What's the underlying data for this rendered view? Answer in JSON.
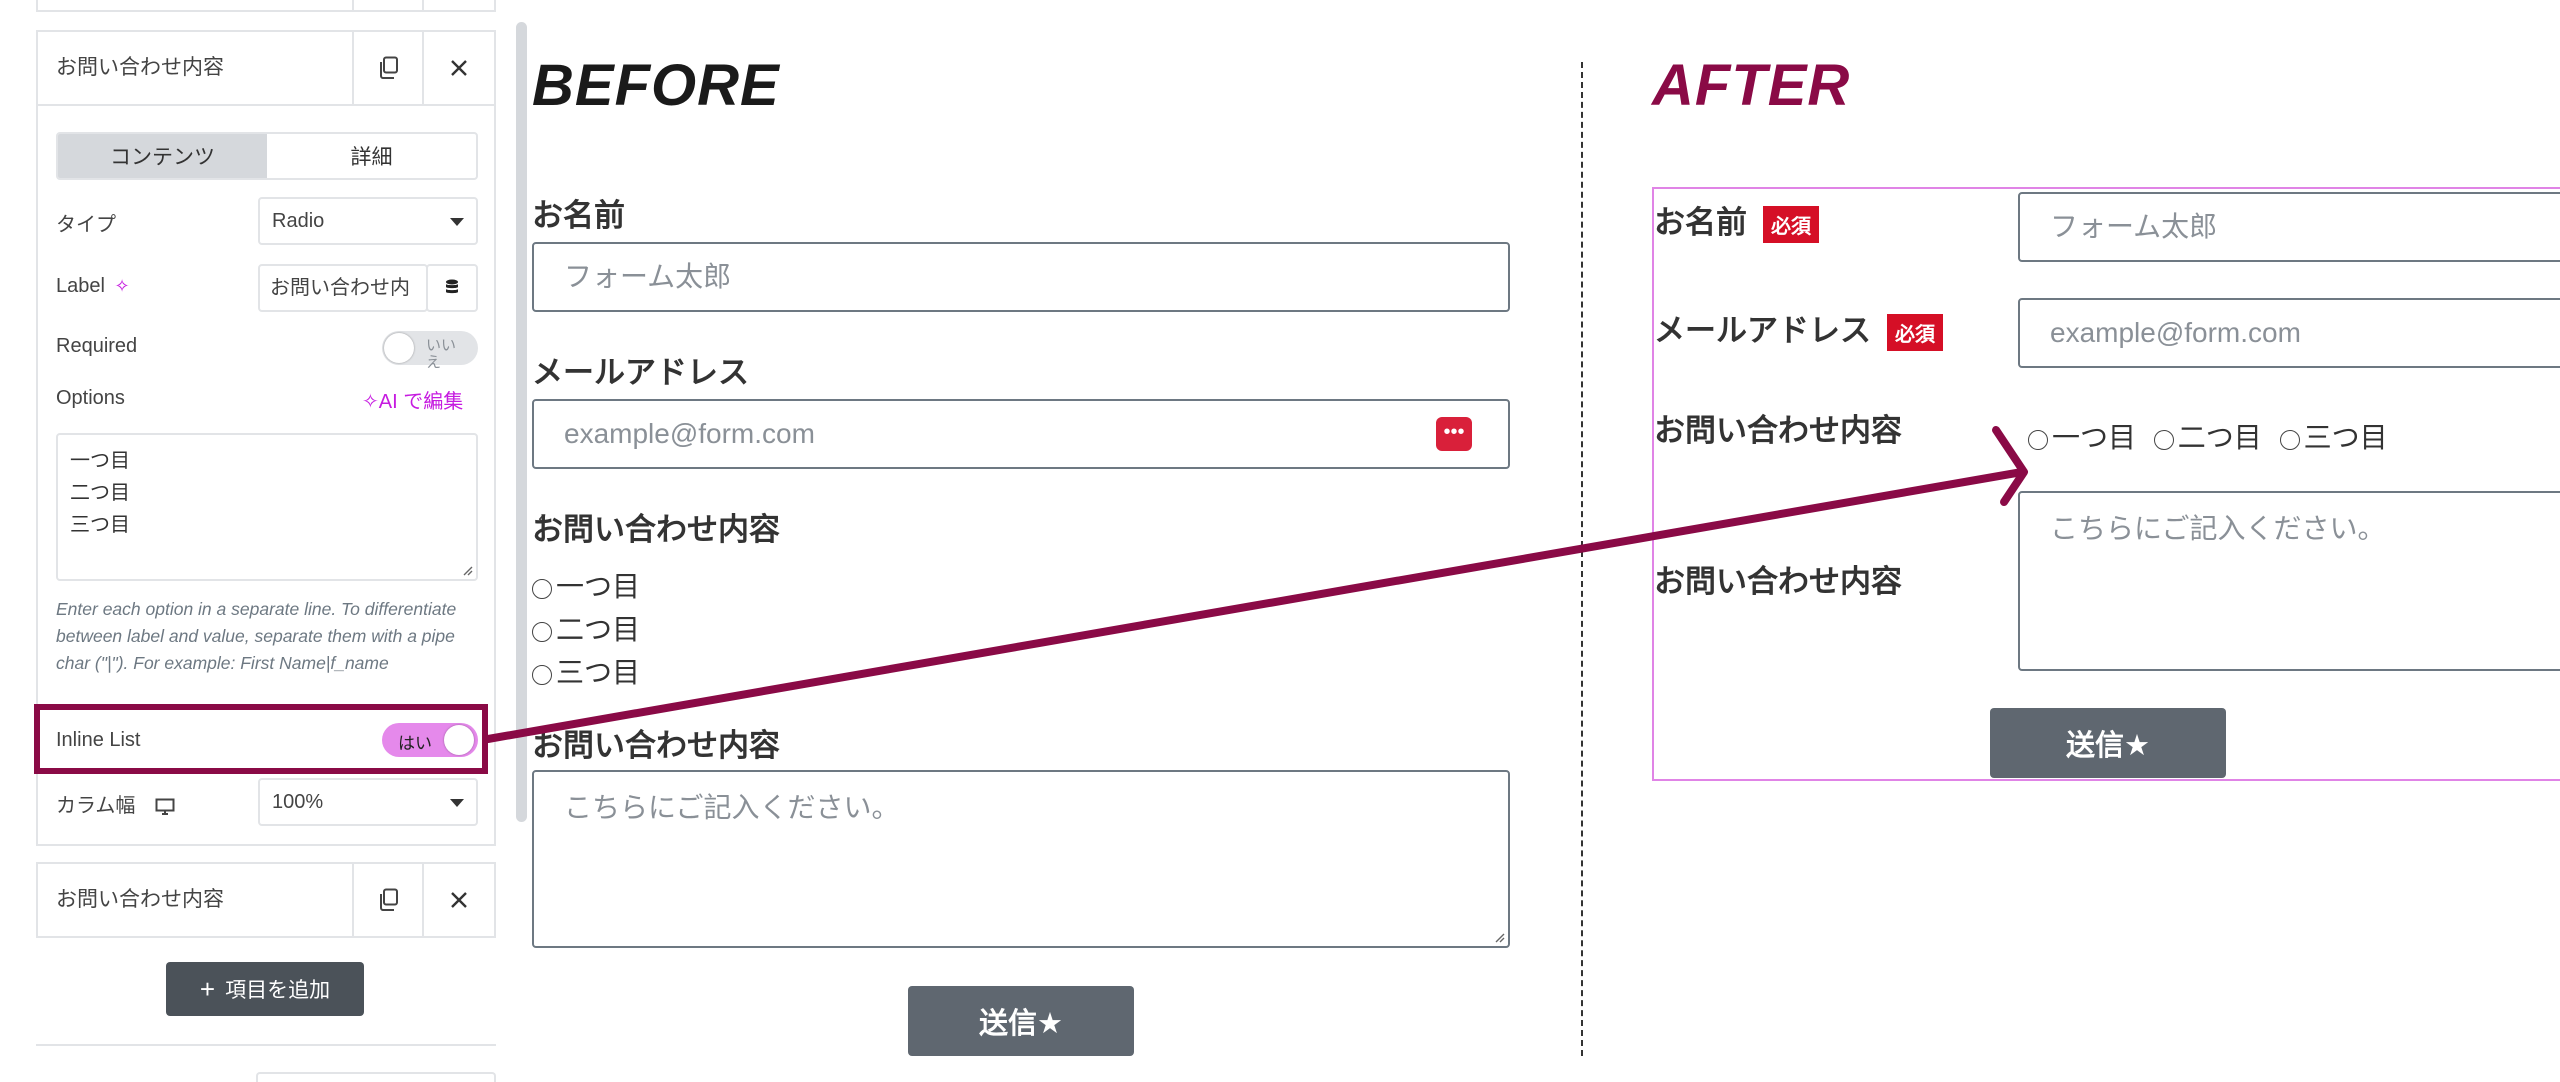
{
  "panel": {
    "card1": {
      "title": "お問い合わせ内容"
    },
    "tabs": [
      "コンテンツ",
      "詳細"
    ],
    "type": {
      "label": "タイプ",
      "value": "Radio"
    },
    "label_field": {
      "label": "Label",
      "value": "お問い合わせ内"
    },
    "required": {
      "label": "Required",
      "value": "いいえ"
    },
    "options": {
      "label": "Options",
      "ai_edit": "AI で編集",
      "items": [
        "一つ目",
        "二つ目",
        "三つ目"
      ],
      "help": "Enter each option in a separate line. To differentiate between label and value, separate them with a pipe char (\"|\"). For example: First Name|f_name"
    },
    "inline_list": {
      "label": "Inline List",
      "value": "はい"
    },
    "column_width": {
      "label": "カラム幅",
      "value": "100%"
    },
    "card2": {
      "title": "お問い合わせ内容"
    },
    "add_item": "項目を追加"
  },
  "before": {
    "heading": "BEFORE",
    "name_label": "お名前",
    "name_placeholder": "フォーム太郎",
    "email_label": "メールアドレス",
    "email_placeholder": "example@form.com",
    "inquiry_label": "お問い合わせ内容",
    "radios": [
      "一つ目",
      "二つ目",
      "三つ目"
    ],
    "message_label": "お問い合わせ内容",
    "message_placeholder": "こちらにご記入ください。",
    "submit": "送信★"
  },
  "after": {
    "heading": "AFTER",
    "name_label": "お名前",
    "required_badge": "必須",
    "name_placeholder": "フォーム太郎",
    "email_label": "メールアドレス",
    "email_placeholder": "example@form.com",
    "inquiry_label": "お問い合わせ内容",
    "radios": [
      "一つ目",
      "二つ目",
      "三つ目"
    ],
    "message_label": "お問い合わせ内容",
    "message_placeholder": "こちらにご記入ください。",
    "submit": "送信★"
  },
  "colors": {
    "accent": "#8a0a46",
    "highlight": "#e084e6",
    "toggle_on": "#e589eb",
    "badge": "#d50f26",
    "button": "#5f6770"
  }
}
